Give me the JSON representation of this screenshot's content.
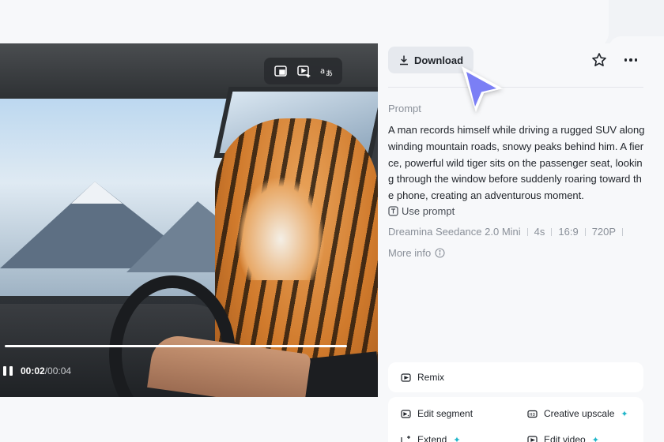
{
  "video": {
    "controls": {
      "current_time": "00:02",
      "separator": "/",
      "total_time": "00:04"
    },
    "tools": {
      "tool1_icon": "picture-in-picture-icon",
      "tool2_icon": "video-sparkle-icon",
      "tool3_icon": "translate-icon"
    },
    "progress_fraction": 1.0
  },
  "panel": {
    "download_label": "Download",
    "prompt_heading": "Prompt",
    "prompt_text": "A man records himself while driving a rugged SUV along winding mountain roads, snowy peaks behind him. A fierce, powerful wild tiger sits on the passenger seat, looking through the window before suddenly roaring toward the phone, creating an adventurous moment.",
    "use_prompt_label": "Use prompt",
    "meta": [
      "Dreamina Seedance 2.0 Mini",
      "4s",
      "16:9",
      "720P"
    ],
    "more_info_label": "More info",
    "actions": {
      "remix": "Remix",
      "edit_segment": "Edit segment",
      "creative_upscale": "Creative upscale",
      "extend": "Extend",
      "edit_video": "Edit video"
    }
  },
  "colors": {
    "accent_cursor": "#7b7ff5",
    "sparkle": "#1fb5c9",
    "panel_bg": "#f7f8fa"
  }
}
